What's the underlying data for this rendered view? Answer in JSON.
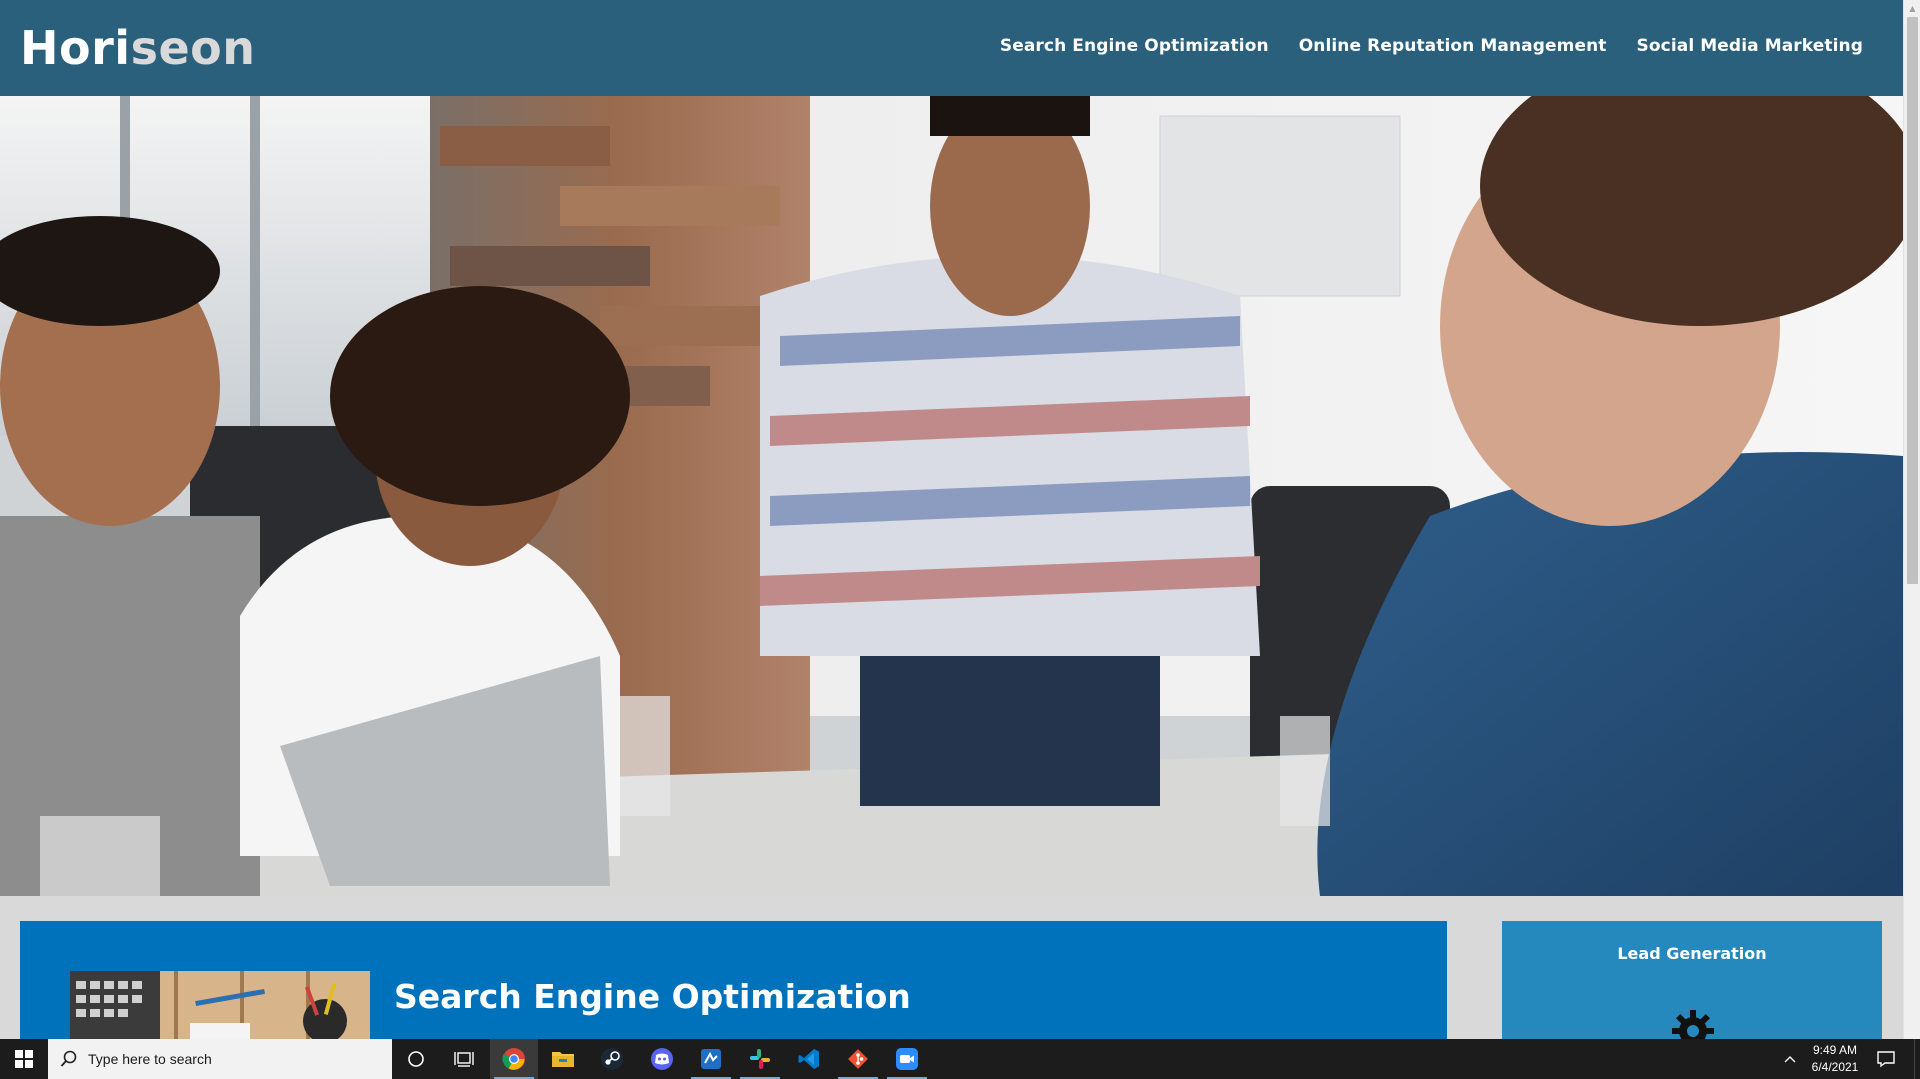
{
  "site": {
    "logo_part1": "Hori",
    "logo_part2": "seon",
    "nav": [
      {
        "label": "Search Engine Optimization"
      },
      {
        "label": "Online Reputation Management"
      },
      {
        "label": "Social Media Marketing"
      }
    ]
  },
  "content": {
    "main_title": "Search Engine Optimization",
    "side_title": "Lead Generation"
  },
  "taskbar": {
    "search_placeholder": "Type here to search",
    "time": "9:49 AM",
    "date": "6/4/2021",
    "apps": [
      {
        "name": "cortana-icon"
      },
      {
        "name": "task-view-icon"
      },
      {
        "name": "chrome-icon",
        "active": true
      },
      {
        "name": "file-explorer-icon"
      },
      {
        "name": "steam-icon"
      },
      {
        "name": "discord-icon"
      },
      {
        "name": "azure-data-studio-icon"
      },
      {
        "name": "slack-icon"
      },
      {
        "name": "vscode-icon"
      },
      {
        "name": "git-icon"
      },
      {
        "name": "zoom-icon"
      }
    ]
  },
  "colors": {
    "header_bg": "#2a607c",
    "main_card": "#0072bb",
    "side_card": "#2589bd",
    "page_bg": "#d9d9d9",
    "taskbar": "#1c1c1c"
  }
}
